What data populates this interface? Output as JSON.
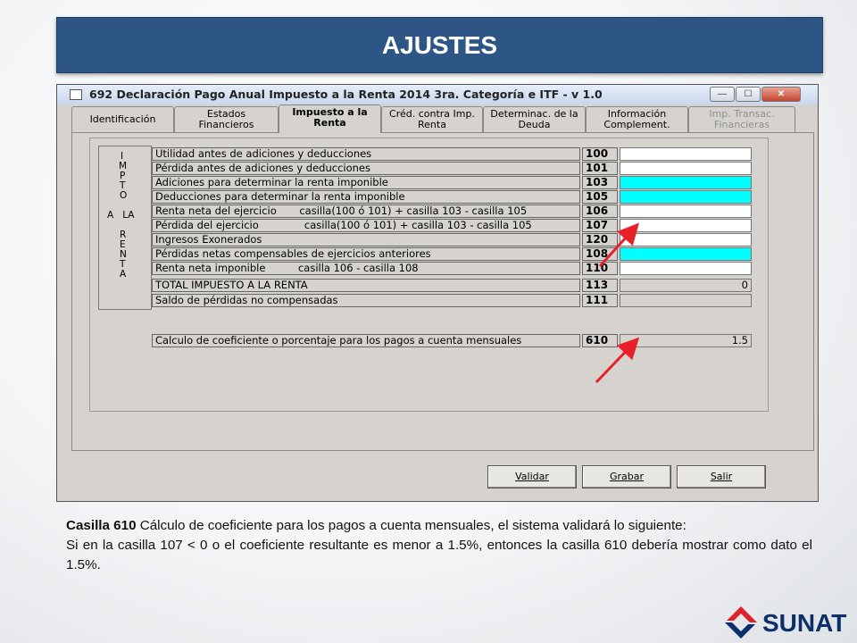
{
  "slide": {
    "title": "AJUSTES"
  },
  "window": {
    "title": "692 Declaración Pago Anual Impuesto a la Renta 2014 3ra. Categoría e ITF - v 1.0",
    "controls": {
      "minimize": "—",
      "maximize": "☐",
      "close": "✕"
    }
  },
  "tabs": [
    {
      "line1": "Identificación",
      "line2": ""
    },
    {
      "line1": "Estados",
      "line2": "Financieros"
    },
    {
      "line1": "Impuesto a la",
      "line2": "Renta"
    },
    {
      "line1": "Créd. contra Imp.",
      "line2": "Renta"
    },
    {
      "line1": "Determinac. de la",
      "line2": "Deuda"
    },
    {
      "line1": "Información",
      "line2": "Complement."
    },
    {
      "line1": "Imp. Transac.",
      "line2": "Financieras"
    }
  ],
  "side_label": [
    "I",
    "M",
    "P",
    "T",
    "O",
    "A   LA",
    "R",
    "E",
    "N",
    "T",
    "A"
  ],
  "rows": [
    {
      "label": "Utilidad antes de adiciones y deducciones",
      "code": "100",
      "value": ""
    },
    {
      "label": "Pérdida antes de adiciones y deducciones",
      "code": "101",
      "value": ""
    },
    {
      "label": "Adiciones para determinar la renta imponible",
      "code": "103",
      "value": ""
    },
    {
      "label": "Deducciones para determinar la renta imponible",
      "code": "105",
      "value": ""
    },
    {
      "label": "Renta neta del ejercicio       casilla(100 ó 101) + casilla 103 - casilla 105",
      "code": "106",
      "value": ""
    },
    {
      "label": "Pérdida del ejercicio              casilla(100 ó 101) + casilla 103 - casilla 105",
      "code": "107",
      "value": ""
    },
    {
      "label": "Ingresos Exonerados",
      "code": "120",
      "value": ""
    },
    {
      "label": "Pérdidas netas compensables de ejercicios anteriores",
      "code": "108",
      "value": ""
    },
    {
      "label": "Renta neta imponible          casilla 106 - casilla 108",
      "code": "110",
      "value": ""
    },
    {
      "label": "TOTAL IMPUESTO A LA RENTA",
      "code": "113",
      "value": "0"
    },
    {
      "label": "Saldo de pérdidas no compensadas",
      "code": "111",
      "value": ""
    },
    {
      "label": "Calculo de coeficiente o porcentaje para los pagos a cuenta mensuales",
      "code": "610",
      "value": "1.5"
    }
  ],
  "buttons": {
    "validar": "Validar",
    "grabar": "Grabar",
    "salir": "Salir"
  },
  "caption": {
    "bold": "Casilla 610",
    "line1": " Cálculo de coeficiente para los pagos a cuenta mensuales, el sistema validará lo siguiente:",
    "line2": "Si en la casilla 107 <  0    o el coeficiente resultante es menor a 1.5%, entonces la casilla 610 debería mostrar como dato el 1.5%."
  },
  "logo": {
    "text": "SUNAT"
  },
  "colors": {
    "banner": "#2d5586",
    "highlight_field": "#00ffff",
    "arrow": "#e8202a"
  }
}
